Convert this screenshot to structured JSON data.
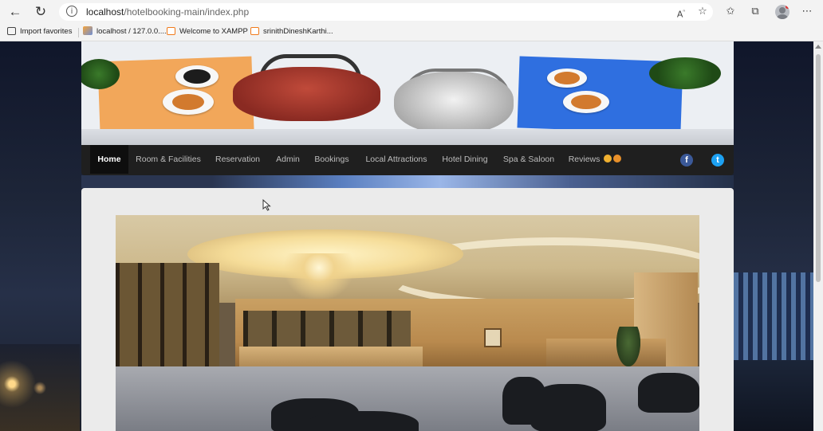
{
  "browser": {
    "url_host": "localhost",
    "url_path": "/hotelbooking-main/index.php",
    "favorites": [
      {
        "label": "Import favorites",
        "icon": "import-icon"
      },
      {
        "label": "localhost / 127.0.0....",
        "icon": "phpmyadmin-icon"
      },
      {
        "label": "Welcome to XAMPP",
        "icon": "xampp-icon"
      },
      {
        "label": "srinithDineshKarthi...",
        "icon": "xampp-icon"
      }
    ]
  },
  "site": {
    "nav": [
      {
        "label": "Home",
        "active": true
      },
      {
        "label": "Room & Facilities"
      },
      {
        "label": "Reservation"
      },
      {
        "label": "Admin"
      },
      {
        "label": "Bookings"
      },
      {
        "label": "Local Attractions"
      },
      {
        "label": "Hotel Dining"
      },
      {
        "label": "Spa & Saloon"
      },
      {
        "label": "Reviews"
      }
    ],
    "social": [
      {
        "icon": "facebook-icon",
        "glyph": "f",
        "color": "#3b5998"
      },
      {
        "icon": "twitter-icon",
        "glyph": "t",
        "color": "#1da1f2"
      }
    ]
  }
}
